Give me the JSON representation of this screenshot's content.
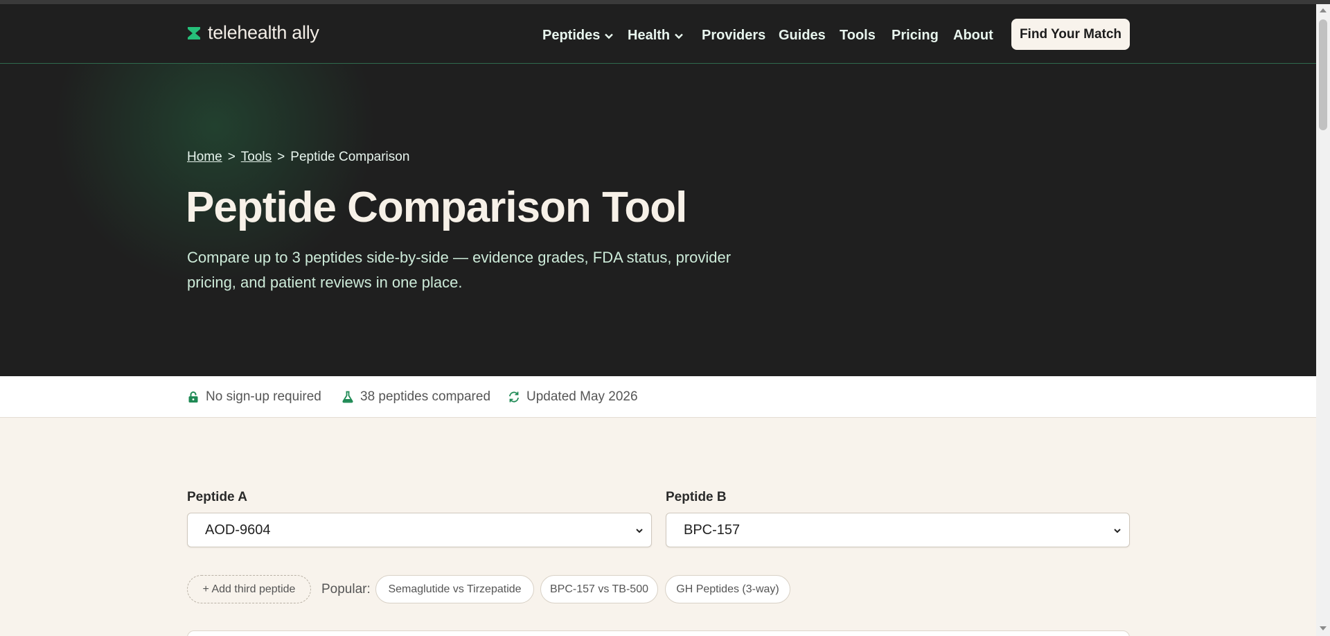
{
  "brand": {
    "name": "telehealth ally",
    "accent": "#26c07a"
  },
  "nav": {
    "items": [
      {
        "label": "Peptides",
        "dropdown": true
      },
      {
        "label": "Health",
        "dropdown": true
      },
      {
        "label": "Providers",
        "dropdown": false
      },
      {
        "label": "Guides",
        "dropdown": false
      },
      {
        "label": "Tools",
        "dropdown": false
      },
      {
        "label": "Pricing",
        "dropdown": false
      },
      {
        "label": "About",
        "dropdown": false
      }
    ],
    "cta": "Find Your Match"
  },
  "breadcrumb": {
    "home": "Home",
    "tools": "Tools",
    "current": "Peptide Comparison",
    "separator": ">"
  },
  "hero": {
    "title": "Peptide Comparison Tool",
    "subtitle": "Compare up to 3 peptides side-by-side — evidence grades, FDA status, provider pricing, and patient reviews in one place."
  },
  "trust": [
    {
      "icon": "lock-icon",
      "text": "No sign-up required"
    },
    {
      "icon": "flask-icon",
      "text": "38 peptides compared"
    },
    {
      "icon": "refresh-icon",
      "text": "Updated May 2026"
    }
  ],
  "compare": {
    "peptide_a": {
      "label": "Peptide A",
      "value": "AOD-9604"
    },
    "peptide_b": {
      "label": "Peptide B",
      "value": "BPC-157"
    },
    "add_third": "+ Add third peptide",
    "popular_label": "Popular:",
    "popular": [
      "Semaglutide vs Tirzepatide",
      "BPC-157 vs TB-500",
      "GH Peptides (3-way)"
    ]
  },
  "colors": {
    "header_bg": "#1f1f1f",
    "page_bg": "#f8f3ec",
    "cta_bg": "#f8f3ec",
    "icon_green": "#1f8a55"
  }
}
